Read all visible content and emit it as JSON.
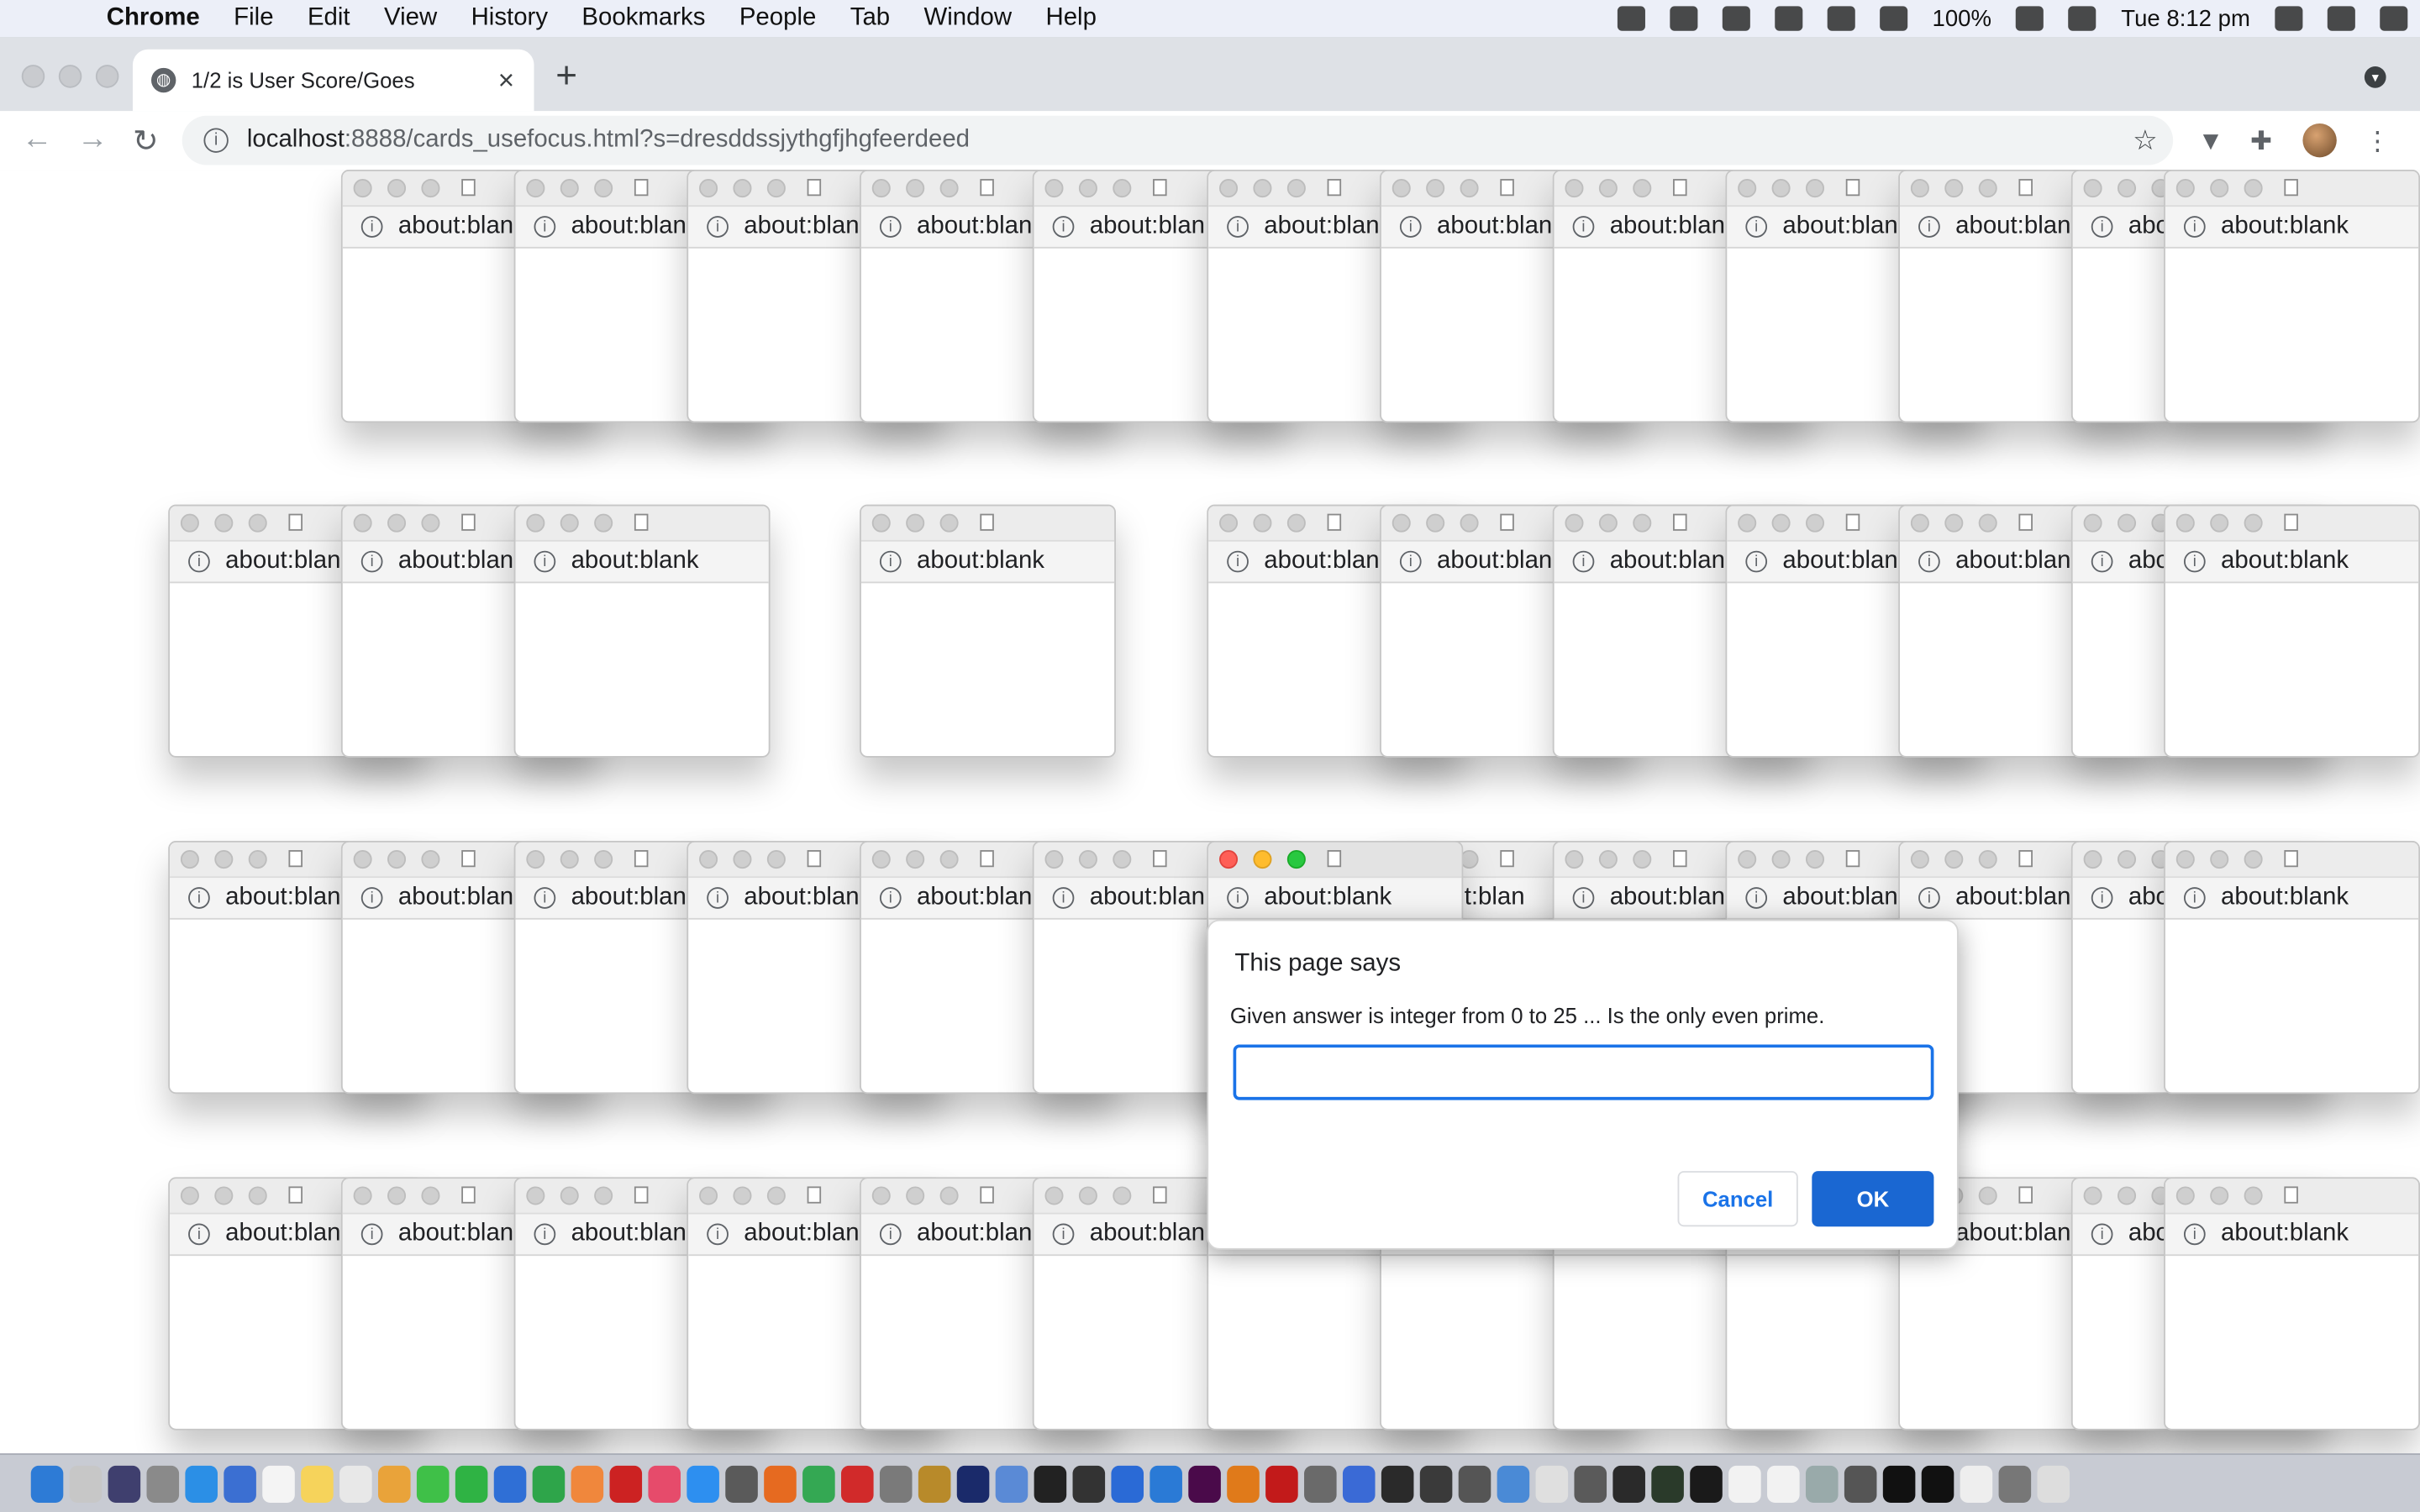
{
  "menubar": {
    "app": "Chrome",
    "items": [
      "File",
      "Edit",
      "View",
      "History",
      "Bookmarks",
      "People",
      "Tab",
      "Window",
      "Help"
    ],
    "battery": "100%",
    "clock": "Tue 8:12 pm"
  },
  "browser": {
    "tab_title": "1/2 is User Score/Goes",
    "url_host": "localhost",
    "url_rest": ":8888/cards_usefocus.html?s=dresddssjythgfjhgfeerdeed"
  },
  "popup_label": "about:blank",
  "popup_label_truncated": "about:blan",
  "popup_label_short": "abo",
  "popup_label_partial": "out:blan",
  "dialog": {
    "title": "This page says",
    "message": "Given answer is integer from 0 to 25 ... Is the only even prime.",
    "input_value": "",
    "cancel_label": "Cancel",
    "ok_label": "OK"
  },
  "colors": {
    "accent": "#1a67d2",
    "close": "#fe5f57",
    "minimize": "#febc2e",
    "zoom": "#28c840"
  }
}
